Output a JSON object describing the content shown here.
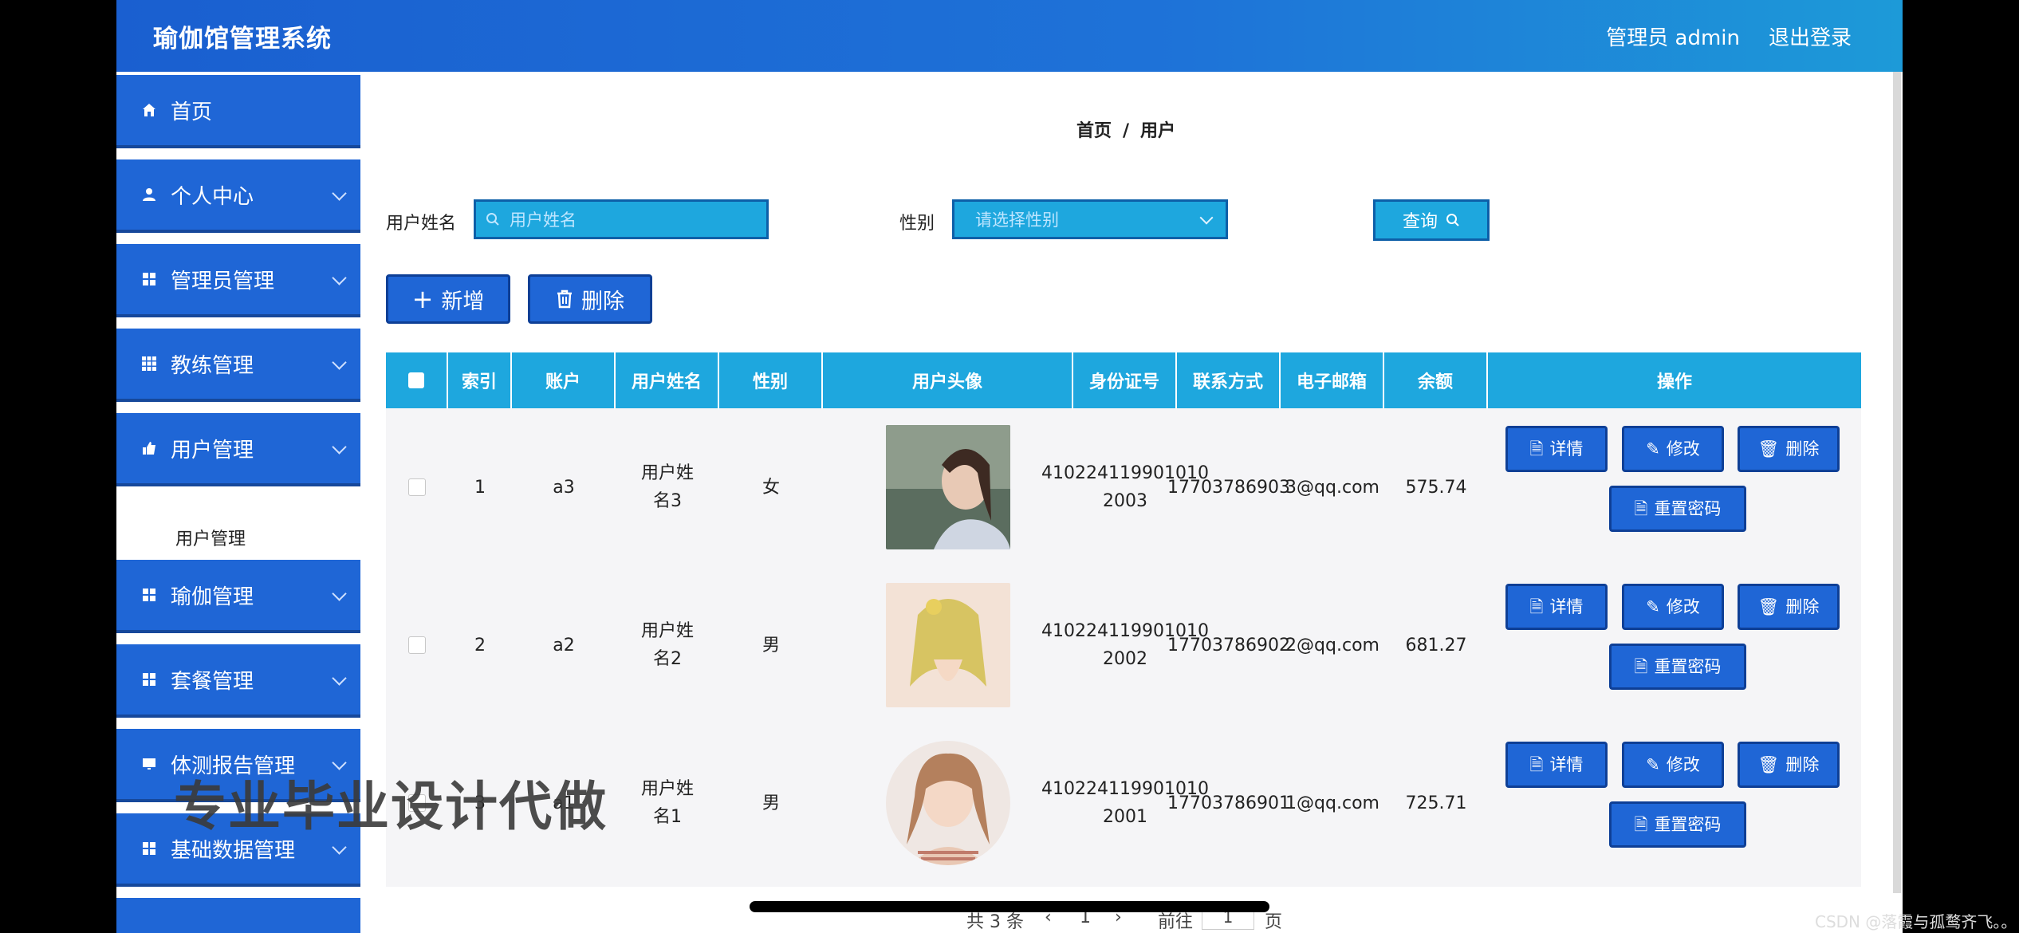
{
  "header": {
    "brand": "瑜伽馆管理系统",
    "admin": "管理员 admin",
    "logout": "退出登录"
  },
  "sidebar": {
    "items": [
      {
        "label": "首页"
      },
      {
        "label": "个人中心"
      },
      {
        "label": "管理员管理"
      },
      {
        "label": "教练管理"
      },
      {
        "label": "用户管理"
      },
      {
        "label": "瑜伽管理"
      },
      {
        "label": "套餐管理"
      },
      {
        "label": "体测报告管理"
      },
      {
        "label": "基础数据管理"
      }
    ],
    "sub_item": "用户管理"
  },
  "breadcrumb": {
    "home": "首页",
    "sep": "/",
    "current": "用户"
  },
  "search": {
    "name_label": "用户姓名",
    "name_placeholder": "用户姓名",
    "gender_label": "性别",
    "gender_placeholder": "请选择性别",
    "query_label": "查询"
  },
  "actions": {
    "add": "新增",
    "delete": "删除"
  },
  "table": {
    "headers": [
      "索引",
      "账户",
      "用户姓名",
      "性别",
      "用户头像",
      "身份证号",
      "联系方式",
      "电子邮箱",
      "余额",
      "操作"
    ],
    "rows": [
      {
        "index": "1",
        "account": "a3",
        "name": "用户姓名3",
        "gender": "女",
        "idno": "410224119901010 2003",
        "phone": "17703786903",
        "email": "3@qq.com",
        "balance": "575.74"
      },
      {
        "index": "2",
        "account": "a2",
        "name": "用户姓名2",
        "gender": "男",
        "idno": "410224119901010 2002",
        "phone": "17703786902",
        "email": "2@qq.com",
        "balance": "681.27"
      },
      {
        "index": "3",
        "account": "a1",
        "name": "用户姓名1",
        "gender": "男",
        "idno": "410224119901010 2001",
        "phone": "17703786901",
        "email": "1@qq.com",
        "balance": "725.71"
      }
    ],
    "row_buttons": {
      "detail": "详情",
      "edit": "修改",
      "delete": "删除",
      "reset": "重置密码"
    }
  },
  "pager": {
    "total": "共 3 条",
    "goto": "前往",
    "page": "1",
    "page_suffix": "页"
  },
  "overlay": "专业毕业设计代做",
  "watermark": "CSDN @落霞与孤鹜齐飞。。",
  "colors": {
    "header": "#1f66d6",
    "table_head": "#1ea7de",
    "button": "#1f66d6"
  }
}
